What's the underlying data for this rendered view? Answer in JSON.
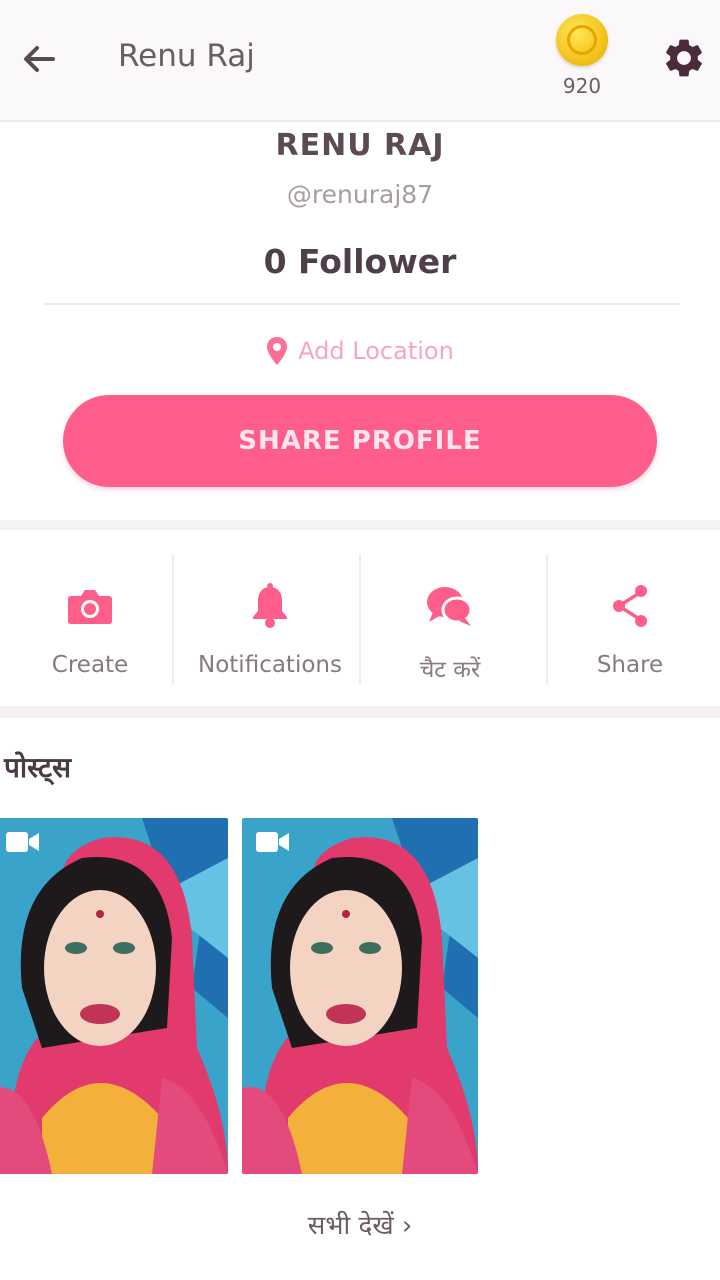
{
  "header": {
    "title": "Renu Raj",
    "coin_count": "920"
  },
  "profile": {
    "name": "RENU RAJ",
    "handle": "@renuraj87",
    "followers": "0 Follower",
    "location_label": "Add Location",
    "share_button": "SHARE PROFILE"
  },
  "actions": [
    {
      "label": "Create",
      "icon": "camera-icon"
    },
    {
      "label": "Notifications",
      "icon": "bell-icon"
    },
    {
      "label": "चैट करें",
      "icon": "chat-icon"
    },
    {
      "label": "Share",
      "icon": "share-icon"
    }
  ],
  "posts": {
    "heading": "पोस्ट्स",
    "see_all": "सभी देखें ›",
    "items": [
      {
        "type": "video"
      },
      {
        "type": "video"
      }
    ]
  },
  "colors": {
    "accent": "#ff5e8a",
    "coin": "#f4c21c"
  }
}
